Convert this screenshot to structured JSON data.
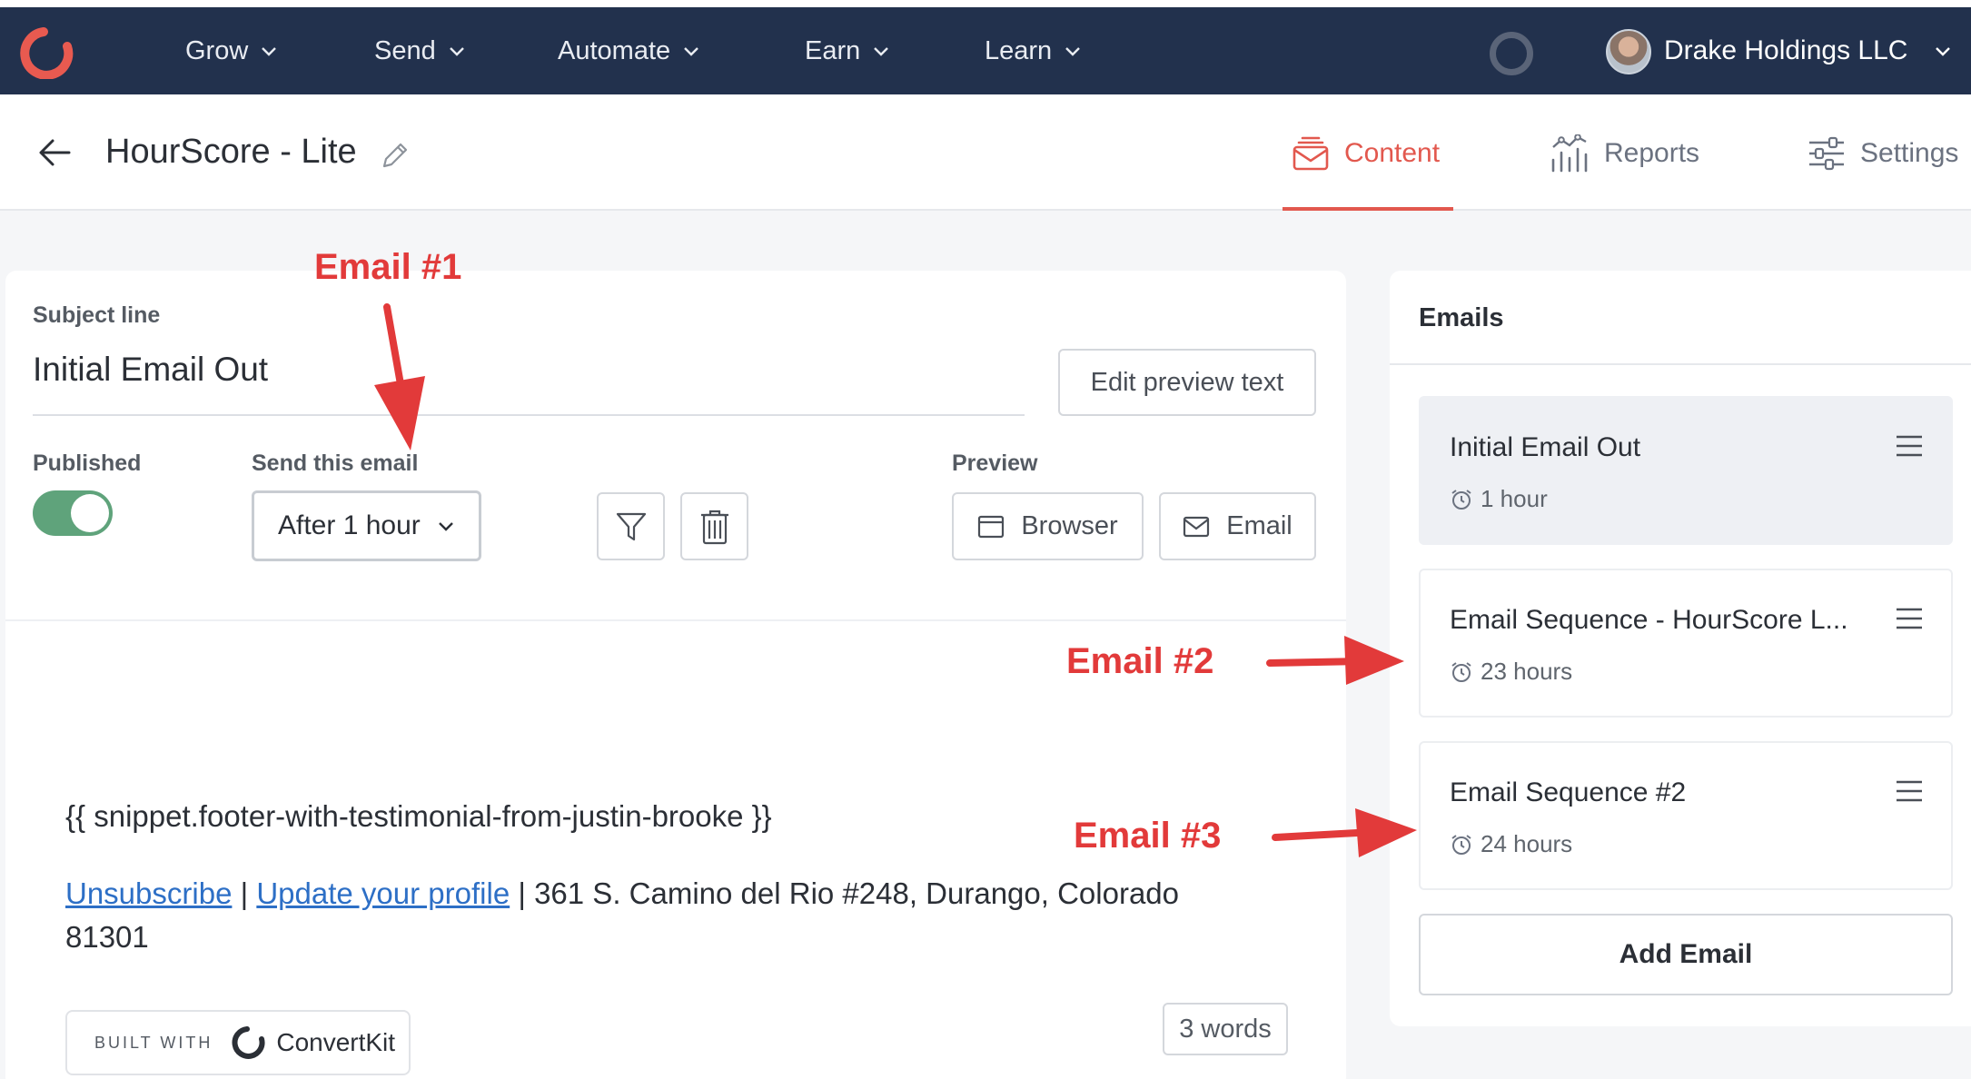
{
  "nav": {
    "items": [
      {
        "label": "Grow"
      },
      {
        "label": "Send"
      },
      {
        "label": "Automate"
      },
      {
        "label": "Earn"
      },
      {
        "label": "Learn"
      }
    ],
    "account_name": "Drake Holdings LLC"
  },
  "header": {
    "title": "HourScore - Lite",
    "tabs": [
      {
        "label": "Content",
        "active": true
      },
      {
        "label": "Reports",
        "active": false
      },
      {
        "label": "Settings",
        "active": false
      }
    ]
  },
  "editor": {
    "subject_label": "Subject line",
    "subject_value": "Initial Email Out",
    "edit_preview_label": "Edit preview text",
    "published_label": "Published",
    "published": true,
    "send_label": "Send this email",
    "send_value": "After 1 hour",
    "preview_label": "Preview",
    "preview_browser": "Browser",
    "preview_email": "Email",
    "snippet": "{{ snippet.footer-with-testimonial-from-justin-brooke }}",
    "footer": {
      "unsubscribe": "Unsubscribe",
      "separator1": " | ",
      "update_profile": "Update your profile",
      "address": " | 361 S. Camino del Rio #248, Durango, Colorado 81301"
    },
    "built_with": "BUILT WITH",
    "brand": "ConvertKit",
    "word_count": "3 words"
  },
  "emails": {
    "heading": "Emails",
    "list": [
      {
        "name": "Initial Email Out",
        "delay": "1 hour",
        "selected": true
      },
      {
        "name": "Email Sequence - HourScore L...",
        "delay": "23 hours",
        "selected": false
      },
      {
        "name": "Email Sequence #2",
        "delay": "24 hours",
        "selected": false
      }
    ],
    "add_label": "Add Email"
  },
  "annotations": {
    "email1": "Email #1",
    "email2": "Email #2",
    "email3": "Email #3"
  },
  "colors": {
    "nav_bg": "#22314d",
    "accent": "#e2584e",
    "toggle_on": "#5fa37b",
    "annotation": "#e23a3a",
    "link": "#2d6fc6"
  }
}
